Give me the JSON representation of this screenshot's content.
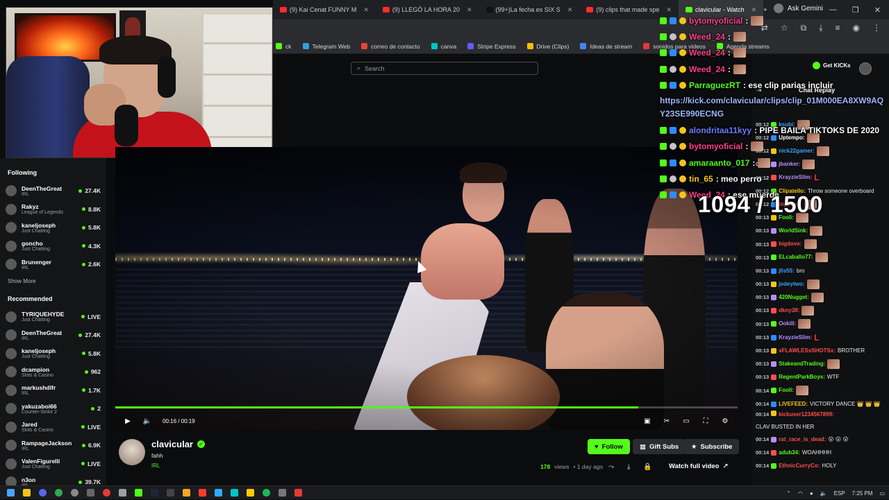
{
  "browser": {
    "tabs": [
      {
        "label": "(9) Kai Cenat FUNNY M",
        "color": "#ff2d2d"
      },
      {
        "label": "(9) LLEGÓ LA HORA 20",
        "color": "#ff2d2d"
      },
      {
        "label": "(99+)La fecha es SIX S",
        "color": "#111111"
      },
      {
        "label": "(9) clips that made spe",
        "color": "#ff2d2d"
      },
      {
        "label": "clavicular - Watch",
        "color": "#53fc18",
        "active": true
      }
    ],
    "ask_gemini": "Ask Gemini",
    "bookmarks": [
      {
        "label": "ck",
        "color": "#53fc18"
      },
      {
        "label": "Telegram Web",
        "color": "#2aa3e0"
      },
      {
        "label": "correo de contacto",
        "color": "#ea4335"
      },
      {
        "label": "canva",
        "color": "#00c4cc"
      },
      {
        "label": "Stripe Express",
        "color": "#635bff"
      },
      {
        "label": "Drive (Clips)",
        "color": "#fbbc04"
      },
      {
        "label": "Ideas de stream",
        "color": "#4285f4"
      },
      {
        "label": "sonidos para videos",
        "color": "#e53935"
      },
      {
        "label": "Agenda streams",
        "color": "#53fc18"
      }
    ]
  },
  "search": {
    "placeholder": "Search"
  },
  "sidebar": {
    "following_heading": "Following",
    "following": [
      {
        "name": "DeenTheGreat",
        "category": "IRL",
        "count": "27.4K"
      },
      {
        "name": "Rakyz",
        "category": "League of Legends",
        "count": "8.8K"
      },
      {
        "name": "kaneljoseph",
        "category": "Just Chatting",
        "count": "5.8K"
      },
      {
        "name": "goncho",
        "category": "Just Chatting",
        "count": "4.3K"
      },
      {
        "name": "Brunenger",
        "category": "IRL",
        "count": "2.6K"
      }
    ],
    "show_more": "Show More",
    "recommended_heading": "Recommended",
    "recommended": [
      {
        "name": "TYRIQUEHYDE",
        "category": "Just Chatting",
        "count": "LIVE"
      },
      {
        "name": "DeenTheGreat",
        "category": "IRL",
        "count": "27.4K"
      },
      {
        "name": "kaneljoseph",
        "category": "Just Chatting",
        "count": "5.8K"
      },
      {
        "name": "dcampion",
        "category": "Slots & Casino",
        "count": "962"
      },
      {
        "name": "markushdlfr",
        "category": "IRL",
        "count": "1.7K"
      },
      {
        "name": "yakuzaboi66",
        "category": "Counter-Strike 2",
        "count": "2"
      },
      {
        "name": "Jared",
        "category": "Slots & Casino",
        "count": "LIVE"
      },
      {
        "name": "RampageJackson",
        "category": "IRL",
        "count": "6.9K"
      },
      {
        "name": "ValenFigurelli",
        "category": "Just Chatting",
        "count": "LIVE"
      },
      {
        "name": "n3on",
        "category": "IRL",
        "count": "39.7K"
      }
    ]
  },
  "player": {
    "time": "00:16 / 00:19",
    "progress": 0.84
  },
  "stream": {
    "streamer": "clavicular",
    "title": "fahh",
    "category": "IRL",
    "follow": "Follow",
    "gift_subs": "Gift Subs",
    "subscribe": "Subscribe",
    "views": "178",
    "views_label": "views",
    "age": "• 1 day ago",
    "watch_full": "Watch full video"
  },
  "chat_panel": {
    "get_kicks": "Get KICKs",
    "title": "Chat Replay",
    "messages": [
      {
        "time": "00:12",
        "user": "ksubi:",
        "color": "#3aa0ff",
        "text": "",
        "emote": true
      },
      {
        "time": "00:12",
        "user": "Uptempo:",
        "color": "#ffffff",
        "text": "",
        "emote": true
      },
      {
        "time": "00:12",
        "user": "nick22gamer:",
        "color": "#3aa0ff",
        "text": "",
        "emote": true
      },
      {
        "time": "00:12",
        "user": "jbanker:",
        "color": "#b98cff",
        "text": "",
        "emote": true
      },
      {
        "time": "00:12",
        "user": "KrayzieSlim:",
        "color": "#b98cff",
        "text": "L",
        "emote": false
      },
      {
        "time": "00:12",
        "user": "Clipatello:",
        "color": "#f5c518",
        "text": "Throw someone overboard",
        "emote": false
      },
      {
        "time": "00:12",
        "user": "bigdove:",
        "color": "#ff4d4d",
        "text": "",
        "emote": true
      },
      {
        "time": "00:13",
        "user": "Fooli:",
        "color": "#53fc18",
        "text": "",
        "emote": true
      },
      {
        "time": "00:13",
        "user": "WorldSink:",
        "color": "#53fc18",
        "text": "",
        "emote": true
      },
      {
        "time": "00:13",
        "user": "bigdove:",
        "color": "#ff4d4d",
        "text": "",
        "emote": true
      },
      {
        "time": "00:13",
        "user": "ELcaballo77:",
        "color": "#53fc18",
        "text": "",
        "emote": true
      },
      {
        "time": "00:13",
        "user": "j0s55:",
        "color": "#3aa0ff",
        "text": "bro",
        "emote": false
      },
      {
        "time": "00:13",
        "user": "jodeytwo:",
        "color": "#3aa0ff",
        "text": "",
        "emote": true
      },
      {
        "time": "00:13",
        "user": "420Nugget:",
        "color": "#53fc18",
        "text": "",
        "emote": true
      },
      {
        "time": "00:13",
        "user": "dkny38:",
        "color": "#ff4d4d",
        "text": "",
        "emote": true
      },
      {
        "time": "00:13",
        "user": "Ookill:",
        "color": "#b98cff",
        "text": "",
        "emote": true
      },
      {
        "time": "00:13",
        "user": "KrayzieSlim:",
        "color": "#b98cff",
        "text": "L",
        "emote": false
      },
      {
        "time": "00:13",
        "user": "xFLAWLESsSHOTSx:",
        "color": "#ff4d4d",
        "text": "BROTHER",
        "emote": false
      },
      {
        "time": "00:13",
        "user": "StakeandTrading:",
        "color": "#53fc18",
        "text": "",
        "emote": true
      },
      {
        "time": "00:13",
        "user": "RegentParkBoys:",
        "color": "#53fc18",
        "text": "WTF",
        "emote": false
      },
      {
        "time": "00:14",
        "user": "Fooli:",
        "color": "#53fc18",
        "text": "",
        "emote": true
      },
      {
        "time": "00:14",
        "user": "LIVEFEED:",
        "color": "#f5c518",
        "text": "VICTORY DANCE 👑 👑 👑",
        "emote": false
      },
      {
        "time": "00:14",
        "user": "kickuser1234567899:",
        "color": "#ff4d4d",
        "text": "CLAV BUSTED IN HER",
        "emote": false,
        "wrap": true
      },
      {
        "time": "00:14",
        "user": "rat_race_is_dead:",
        "color": "#ff4d4d",
        "text": "😮 😮 😮",
        "emote": false
      },
      {
        "time": "00:14",
        "user": "adub34:",
        "color": "#53fc18",
        "text": "WOAHHHH",
        "emote": false
      },
      {
        "time": "00:14",
        "user": "EthnicCurryCo:",
        "color": "#ff4d4d",
        "text": "HOLY",
        "emote": false
      }
    ]
  },
  "overlay_chat": [
    {
      "user": "bytomyoficial",
      "text": ":",
      "emote": true
    },
    {
      "user": "Weed_24",
      "text": ":",
      "emote": true
    },
    {
      "user": "Weed_24",
      "text": ":",
      "emote": true
    },
    {
      "user": "Weed_24",
      "text": ":",
      "emote": true
    },
    {
      "user": "ParraguezRT",
      "text": ": ese clip parias incluir",
      "user_color": "#53fc18"
    },
    {
      "user": "",
      "text": "https://kick.com/clavicular/clips/clip_01M000EA8XW9AQY23SE990ECNG",
      "link": true
    },
    {
      "user": "alondritaa11kyy",
      "text": ": PIPE BAILA TIKTOKS DE 2020",
      "user_color": "#6a7bff"
    },
    {
      "user": "bytomyoficial",
      "text": ":",
      "emote": true
    },
    {
      "user": "amaraanto_017",
      "text": ":",
      "emote": true,
      "user_color": "#53fc18"
    },
    {
      "user": "tin_65",
      "text": ": meo perro",
      "user_color": "#f5c518"
    },
    {
      "user": "Weed_24",
      "text": ": ese muerde"
    }
  ],
  "counter": "1094 / 1500",
  "taskbar": {
    "lang": "ESP",
    "time": "7:25 PM"
  }
}
